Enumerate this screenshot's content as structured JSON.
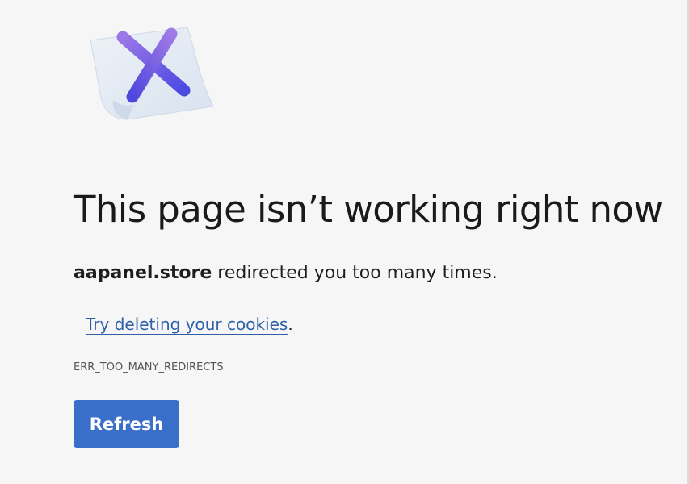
{
  "art": {
    "icon": "broken-page-x-icon"
  },
  "heading": {
    "title": "This page isn’t working right now"
  },
  "message": {
    "domain": "aapanel.store",
    "text": " redirected you too many times."
  },
  "suggestion": {
    "link_text": "Try deleting your cookies",
    "suffix": "."
  },
  "error": {
    "code": "ERR_TOO_MANY_REDIRECTS"
  },
  "actions": {
    "refresh_label": "Refresh"
  },
  "colors": {
    "background": "#f6f6f7",
    "button": "#3a6fc9",
    "link": "#2f5fa8"
  }
}
